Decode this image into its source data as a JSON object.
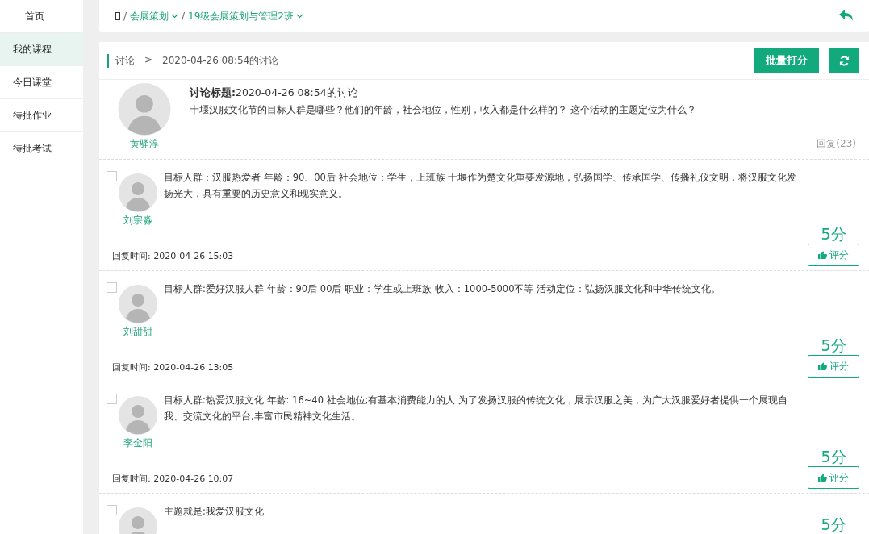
{
  "sidebar": {
    "items": [
      {
        "label": "首页",
        "selected": false
      },
      {
        "label": "我的课程",
        "selected": true
      },
      {
        "label": "今日课堂",
        "selected": false
      },
      {
        "label": "待批作业",
        "selected": false
      },
      {
        "label": "待批考试",
        "selected": false
      }
    ]
  },
  "breadcrumb": {
    "items": [
      {
        "sep": "/",
        "label": "会展策划"
      },
      {
        "sep": "/",
        "label": "19级会展策划与管理2班"
      }
    ]
  },
  "header": {
    "section": "讨论",
    "arrow": ">",
    "current": "2020-04-26 08:54的讨论",
    "batch_button": "批量打分"
  },
  "topic": {
    "author": "黄驿淳",
    "title": "**讨论标题:**2020-04-26 08:54的讨论",
    "question": "十堰汉服文化节的目标人群是哪些？他们的年龄，社会地位，性别，收入都是什么样的？ 这个活动的主题定位为什么？",
    "replies": "回复(23)"
  },
  "replies": [
    {
      "author": "刘宗淼",
      "checked": false,
      "text": "目标人群：汉服热爱者 年龄：90、00后 社会地位：学生，上班族 十堰作为楚文化重要发源地，弘扬国学、传承国学、传播礼仪文明，将汉服文化发扬光大，具有重要的历史意义和现实意义。",
      "time": "回复时间: 2020-04-26 15:03",
      "score": "5分",
      "rate_button": "评分"
    },
    {
      "author": "刘甜甜",
      "checked": false,
      "text": "目标人群:爱好汉服人群 年龄：90后 00后 职业：学生或上班族 收入：1000-5000不等 活动定位：弘扬汉服文化和中华传统文化。",
      "time": "回复时间: 2020-04-26 13:05",
      "score": "5分",
      "rate_button": "评分"
    },
    {
      "author": "李金阳",
      "checked": false,
      "text": "目标人群:热爱汉服文化 年龄: 16~40 社会地位;有基本消费能力的人 为了发扬汉服的传统文化，展示汉服之美，为广大汉服爱好者提供一个展现自我、交流文化的平台,丰富市民精神文化生活。",
      "time": "回复时间: 2020-04-26 10:07",
      "score": "5分",
      "rate_button": "评分"
    },
    {
      "checked": false,
      "text": "主题就是:我爱汉服文化",
      "score": "5分"
    }
  ]
}
